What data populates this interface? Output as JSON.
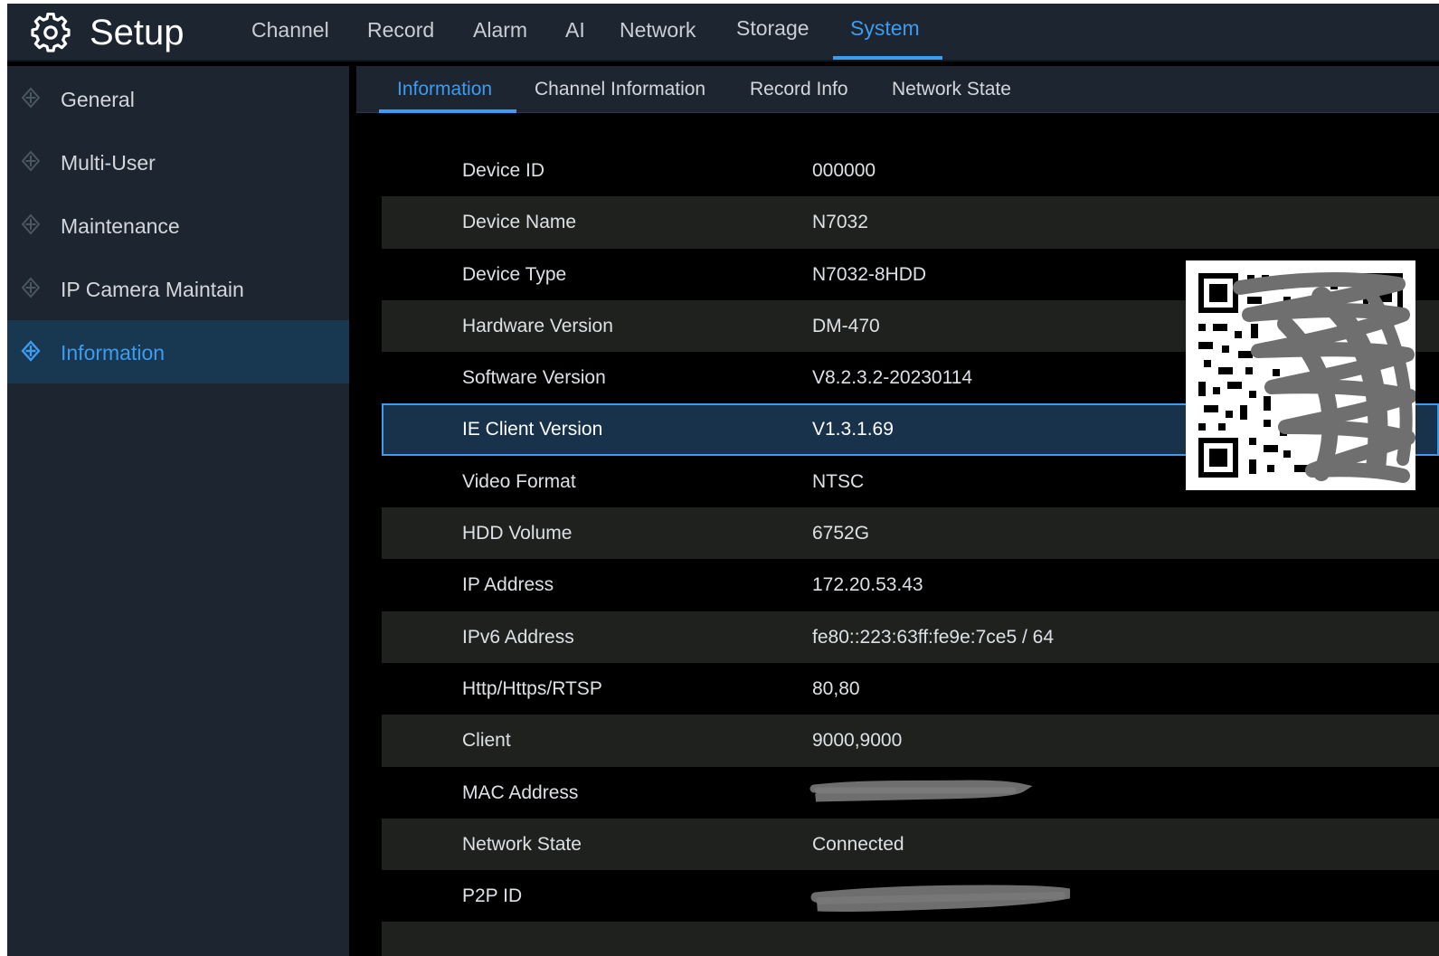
{
  "header": {
    "title": "Setup",
    "nav": [
      {
        "label": "Channel",
        "active": false
      },
      {
        "label": "Record",
        "active": false
      },
      {
        "label": "Alarm",
        "active": false
      },
      {
        "label": "AI",
        "active": false
      },
      {
        "label": "Network",
        "active": false
      },
      {
        "label": "Storage",
        "active": false
      },
      {
        "label": "System",
        "active": true
      }
    ],
    "icon": "gear-icon"
  },
  "sidebar": {
    "items": [
      {
        "label": "General",
        "icon": "diamond-pointer-icon",
        "active": false
      },
      {
        "label": "Multi-User",
        "icon": "diamond-pointer-icon",
        "active": false
      },
      {
        "label": "Maintenance",
        "icon": "diamond-pointer-icon",
        "active": false
      },
      {
        "label": "IP Camera Maintain",
        "icon": "diamond-pointer-icon",
        "active": false
      },
      {
        "label": "Information",
        "icon": "diamond-pointer-icon",
        "active": true
      }
    ]
  },
  "subtabs": [
    {
      "label": "Information",
      "active": true
    },
    {
      "label": "Channel Information",
      "active": false
    },
    {
      "label": "Record Info",
      "active": false
    },
    {
      "label": "Network State",
      "active": false
    }
  ],
  "info": {
    "rows": [
      {
        "label": "Device ID",
        "value": "000000"
      },
      {
        "label": "Device Name",
        "value": "N7032"
      },
      {
        "label": "Device Type",
        "value": "N7032-8HDD"
      },
      {
        "label": "Hardware Version",
        "value": "DM-470"
      },
      {
        "label": "Software Version",
        "value": "V8.2.3.2-20230114"
      },
      {
        "label": "IE Client Version",
        "value": "V1.3.1.69",
        "selected": true
      },
      {
        "label": "Video Format",
        "value": "NTSC"
      },
      {
        "label": "HDD Volume",
        "value": "6752G"
      },
      {
        "label": "IP Address",
        "value": "172.20.53.43"
      },
      {
        "label": "IPv6 Address",
        "value": "fe80::223:63ff:fe9e:7ce5 / 64"
      },
      {
        "label": "Http/Https/RTSP",
        "value": "80,80"
      },
      {
        "label": "Client",
        "value": "9000,9000"
      },
      {
        "label": "MAC Address",
        "value": "",
        "redacted": true
      },
      {
        "label": "Network State",
        "value": "Connected"
      },
      {
        "label": "P2P ID",
        "value": "",
        "redacted": true
      }
    ]
  },
  "colors": {
    "accent": "#3d9cf0",
    "panel": "#1c2530",
    "background": "#000000",
    "row_alt": "#1f211f",
    "selected_row": "#17324a"
  }
}
